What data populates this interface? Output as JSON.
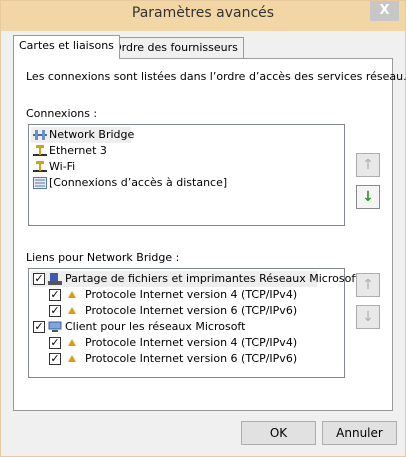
{
  "window": {
    "title": "Paramètres avancés",
    "close_label": "X"
  },
  "tabs": [
    {
      "label": "Cartes et liaisons",
      "active": true
    },
    {
      "label": "Ordre des fournisseurs",
      "active": false
    }
  ],
  "description": "Les connexions sont listées dans l’ordre d’accès des services réseau.",
  "connections": {
    "label": "Connexions :",
    "items": [
      {
        "label": "Network Bridge",
        "icon": "network-bridge-icon",
        "selected": true
      },
      {
        "label": "Ethernet 3",
        "icon": "network-adapter-icon"
      },
      {
        "label": "Wi-Fi",
        "icon": "network-adapter-icon"
      },
      {
        "label": "[Connexions d’accès à distance]",
        "icon": "remote-access-icon"
      }
    ],
    "up_button_icon": "arrow-up-icon",
    "down_button_icon": "arrow-down-green-icon"
  },
  "bindings": {
    "label": "Liens pour Network Bridge :",
    "items": [
      {
        "label": "Partage de fichiers et imprimantes Réseaux Microsoft",
        "checked": true,
        "level": 0,
        "icon": "file-printer-sharing-icon",
        "selected": true
      },
      {
        "label": "Protocole Internet version 4 (TCP/IPv4)",
        "checked": true,
        "level": 1,
        "icon": "protocol-icon"
      },
      {
        "label": "Protocole Internet version 6 (TCP/IPv6)",
        "checked": true,
        "level": 1,
        "icon": "protocol-icon"
      },
      {
        "label": "Client pour les réseaux Microsoft",
        "checked": true,
        "level": 0,
        "icon": "network-client-icon"
      },
      {
        "label": "Protocole Internet version 4 (TCP/IPv4)",
        "checked": true,
        "level": 1,
        "icon": "protocol-icon"
      },
      {
        "label": "Protocole Internet version 6 (TCP/IPv6)",
        "checked": true,
        "level": 1,
        "icon": "protocol-icon"
      }
    ],
    "up_button_icon": "arrow-up-icon",
    "down_button_icon": "arrow-down-icon"
  },
  "buttons": {
    "ok": "OK",
    "cancel": "Annuler"
  },
  "colors": {
    "title_bar": "#f3d6a6",
    "enabled_arrow": "#2a9a2a",
    "disabled_arrow": "#b0b0b0"
  }
}
